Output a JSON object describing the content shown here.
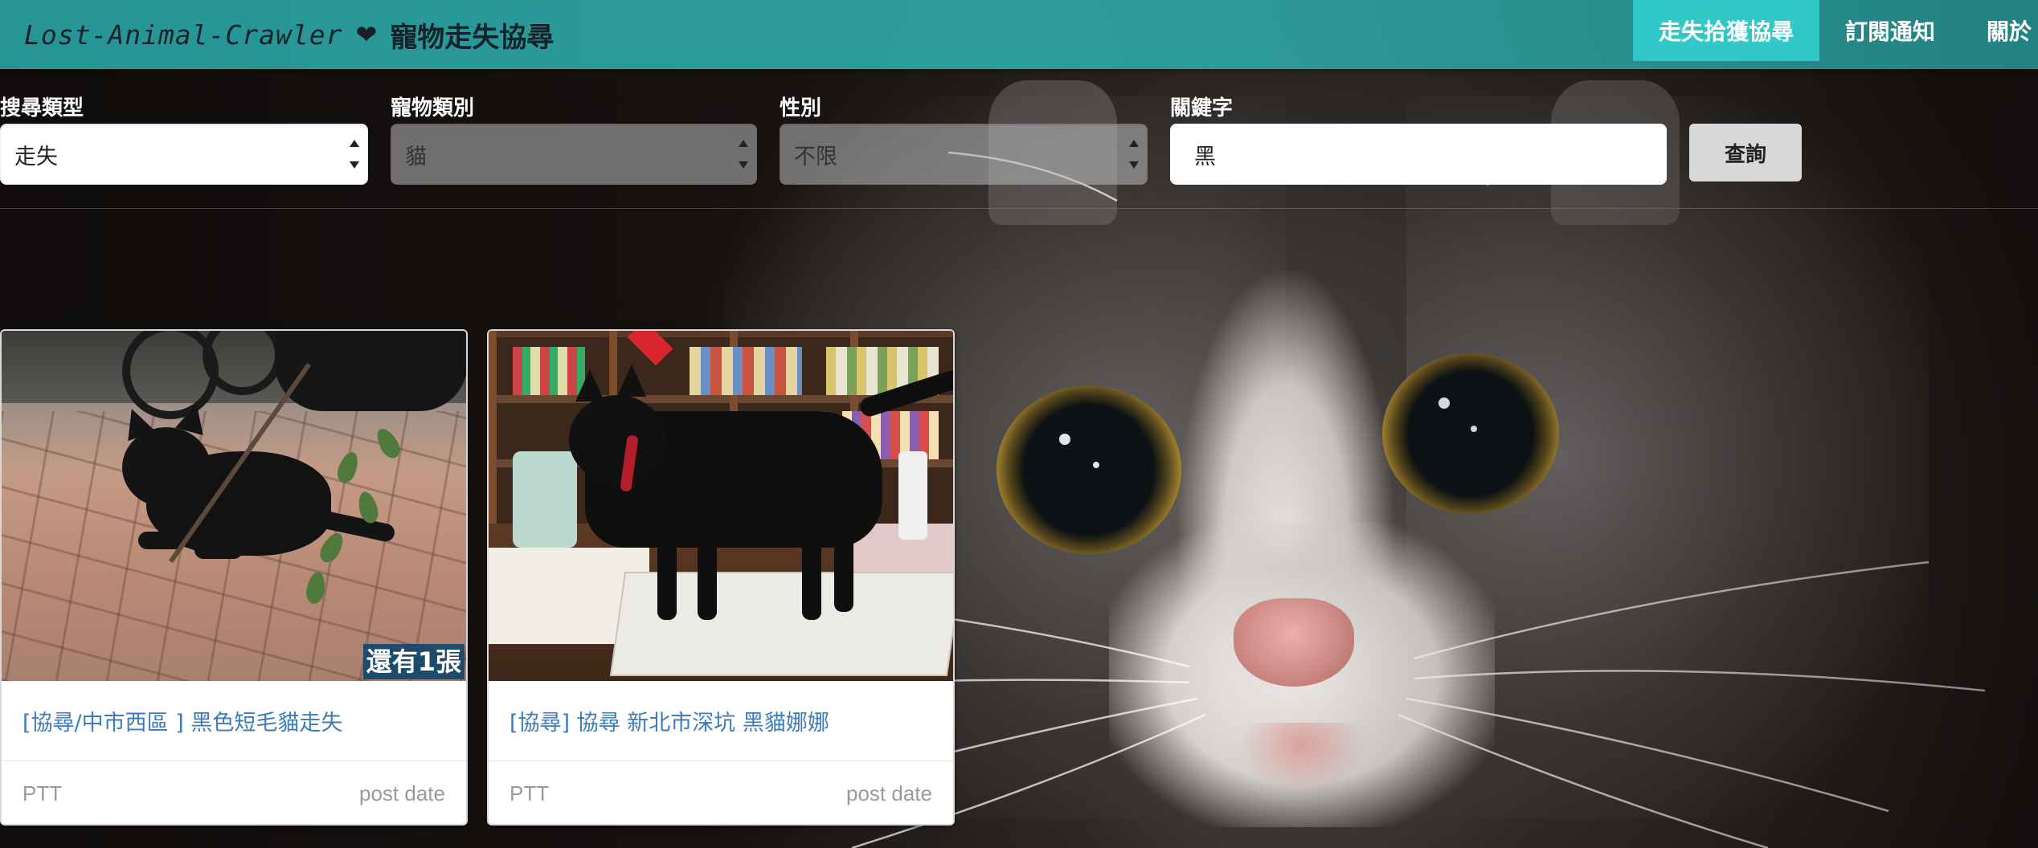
{
  "navbar": {
    "brand_script": "Lost-Animal-Crawler",
    "brand_heart": "❤",
    "brand_zh": "寵物走失協尋",
    "items": [
      {
        "label": "走失拾獲協尋",
        "active": true
      },
      {
        "label": "訂閱通知",
        "active": false
      },
      {
        "label": "關於",
        "active": false
      }
    ]
  },
  "filters": {
    "search_type": {
      "label": "搜尋類型",
      "value": "走失"
    },
    "pet_category": {
      "label": "寵物類別",
      "value": "貓"
    },
    "gender": {
      "label": "性別",
      "value": "不限"
    },
    "keyword": {
      "label": "關鍵字",
      "value": "黑"
    },
    "submit_label": "查詢"
  },
  "results": [
    {
      "title": "[協尋/中市西區 ] 黑色短毛貓走失",
      "source": "PTT",
      "date_label": "post date",
      "more_photos": "還有1張"
    },
    {
      "title": "[協尋] 協尋 新北市深坑 黑貓娜娜",
      "source": "PTT",
      "date_label": "post date"
    }
  ],
  "colors": {
    "navbar": "#2fa8a8",
    "nav_active": "#33c8c8",
    "link": "#3d7bb9",
    "badge": "#1e4a6c"
  }
}
